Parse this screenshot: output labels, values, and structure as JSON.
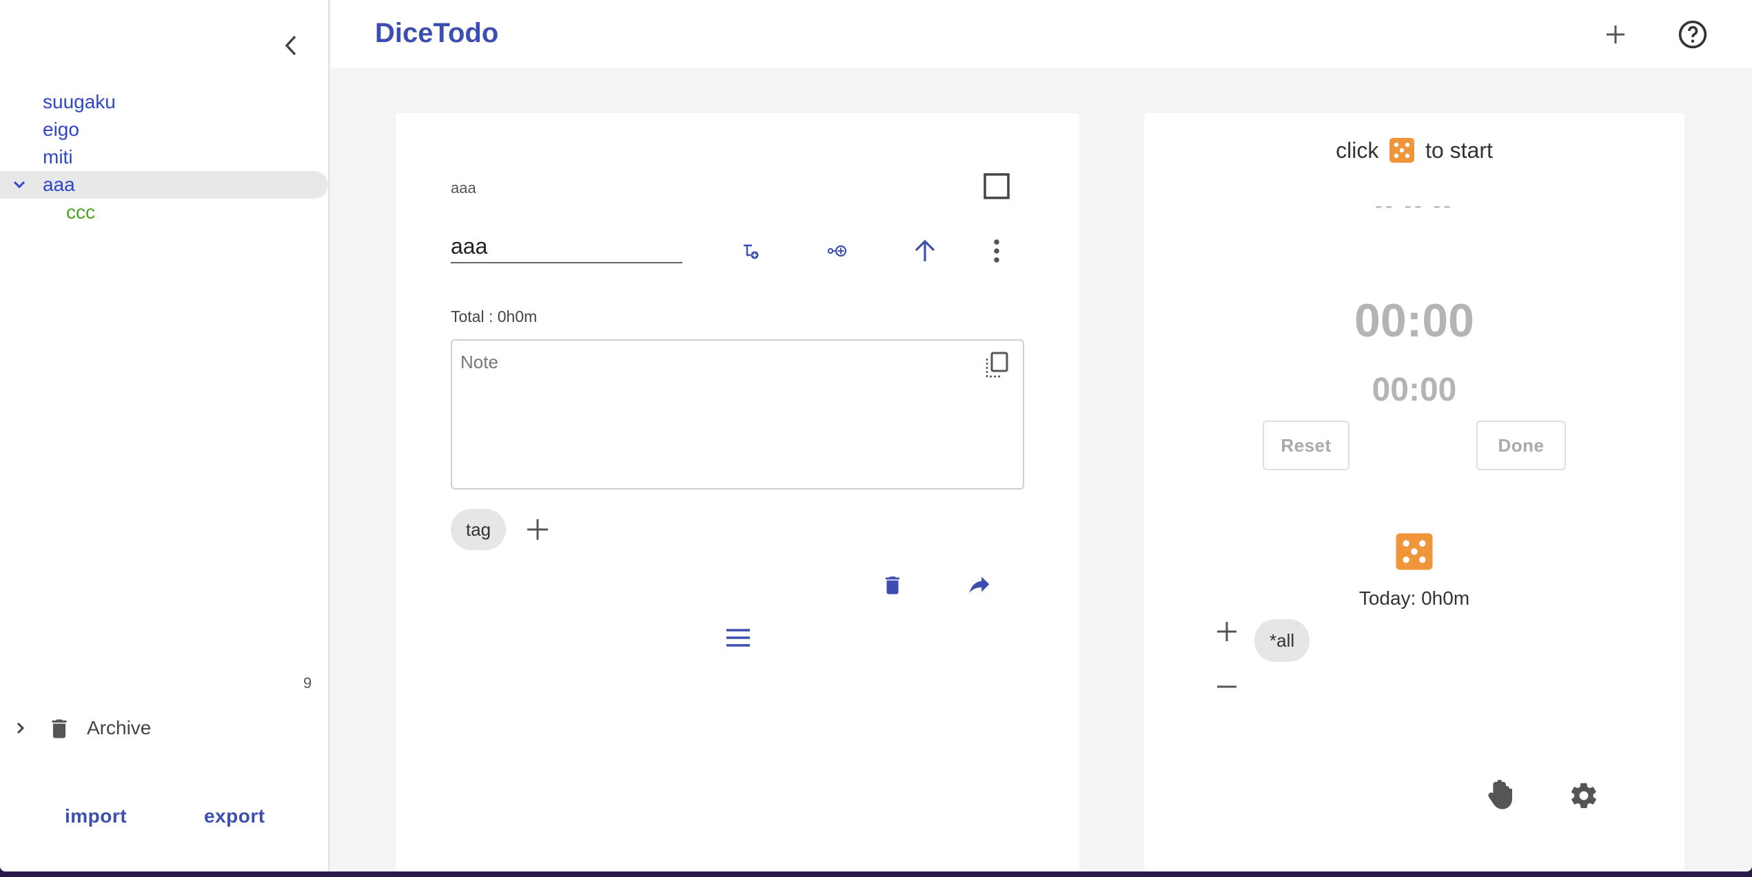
{
  "app": {
    "title": "DiceTodo"
  },
  "sidebar": {
    "items": [
      {
        "label": "suugaku"
      },
      {
        "label": "eigo"
      },
      {
        "label": "miti"
      },
      {
        "label": "aaa"
      },
      {
        "label": "ccc"
      }
    ],
    "count": "9",
    "archive_label": "Archive",
    "import_label": "import",
    "export_label": "export"
  },
  "task": {
    "breadcrumb": "aaa",
    "title_value": "aaa",
    "total": "Total : 0h0m",
    "note_placeholder": "Note",
    "tag_label": "tag"
  },
  "timer": {
    "hint_before": "click",
    "hint_after": "to start",
    "dashes": "-- -- --",
    "main_time": "00:00",
    "sub_time": "00:00",
    "reset_label": "Reset",
    "done_label": "Done",
    "today": "Today: 0h0m",
    "filter_chip": "*all"
  },
  "colors": {
    "accent": "#3c4fb0",
    "link": "#2f46c8",
    "child_item": "#4aa320",
    "dice": "#f0963a"
  }
}
